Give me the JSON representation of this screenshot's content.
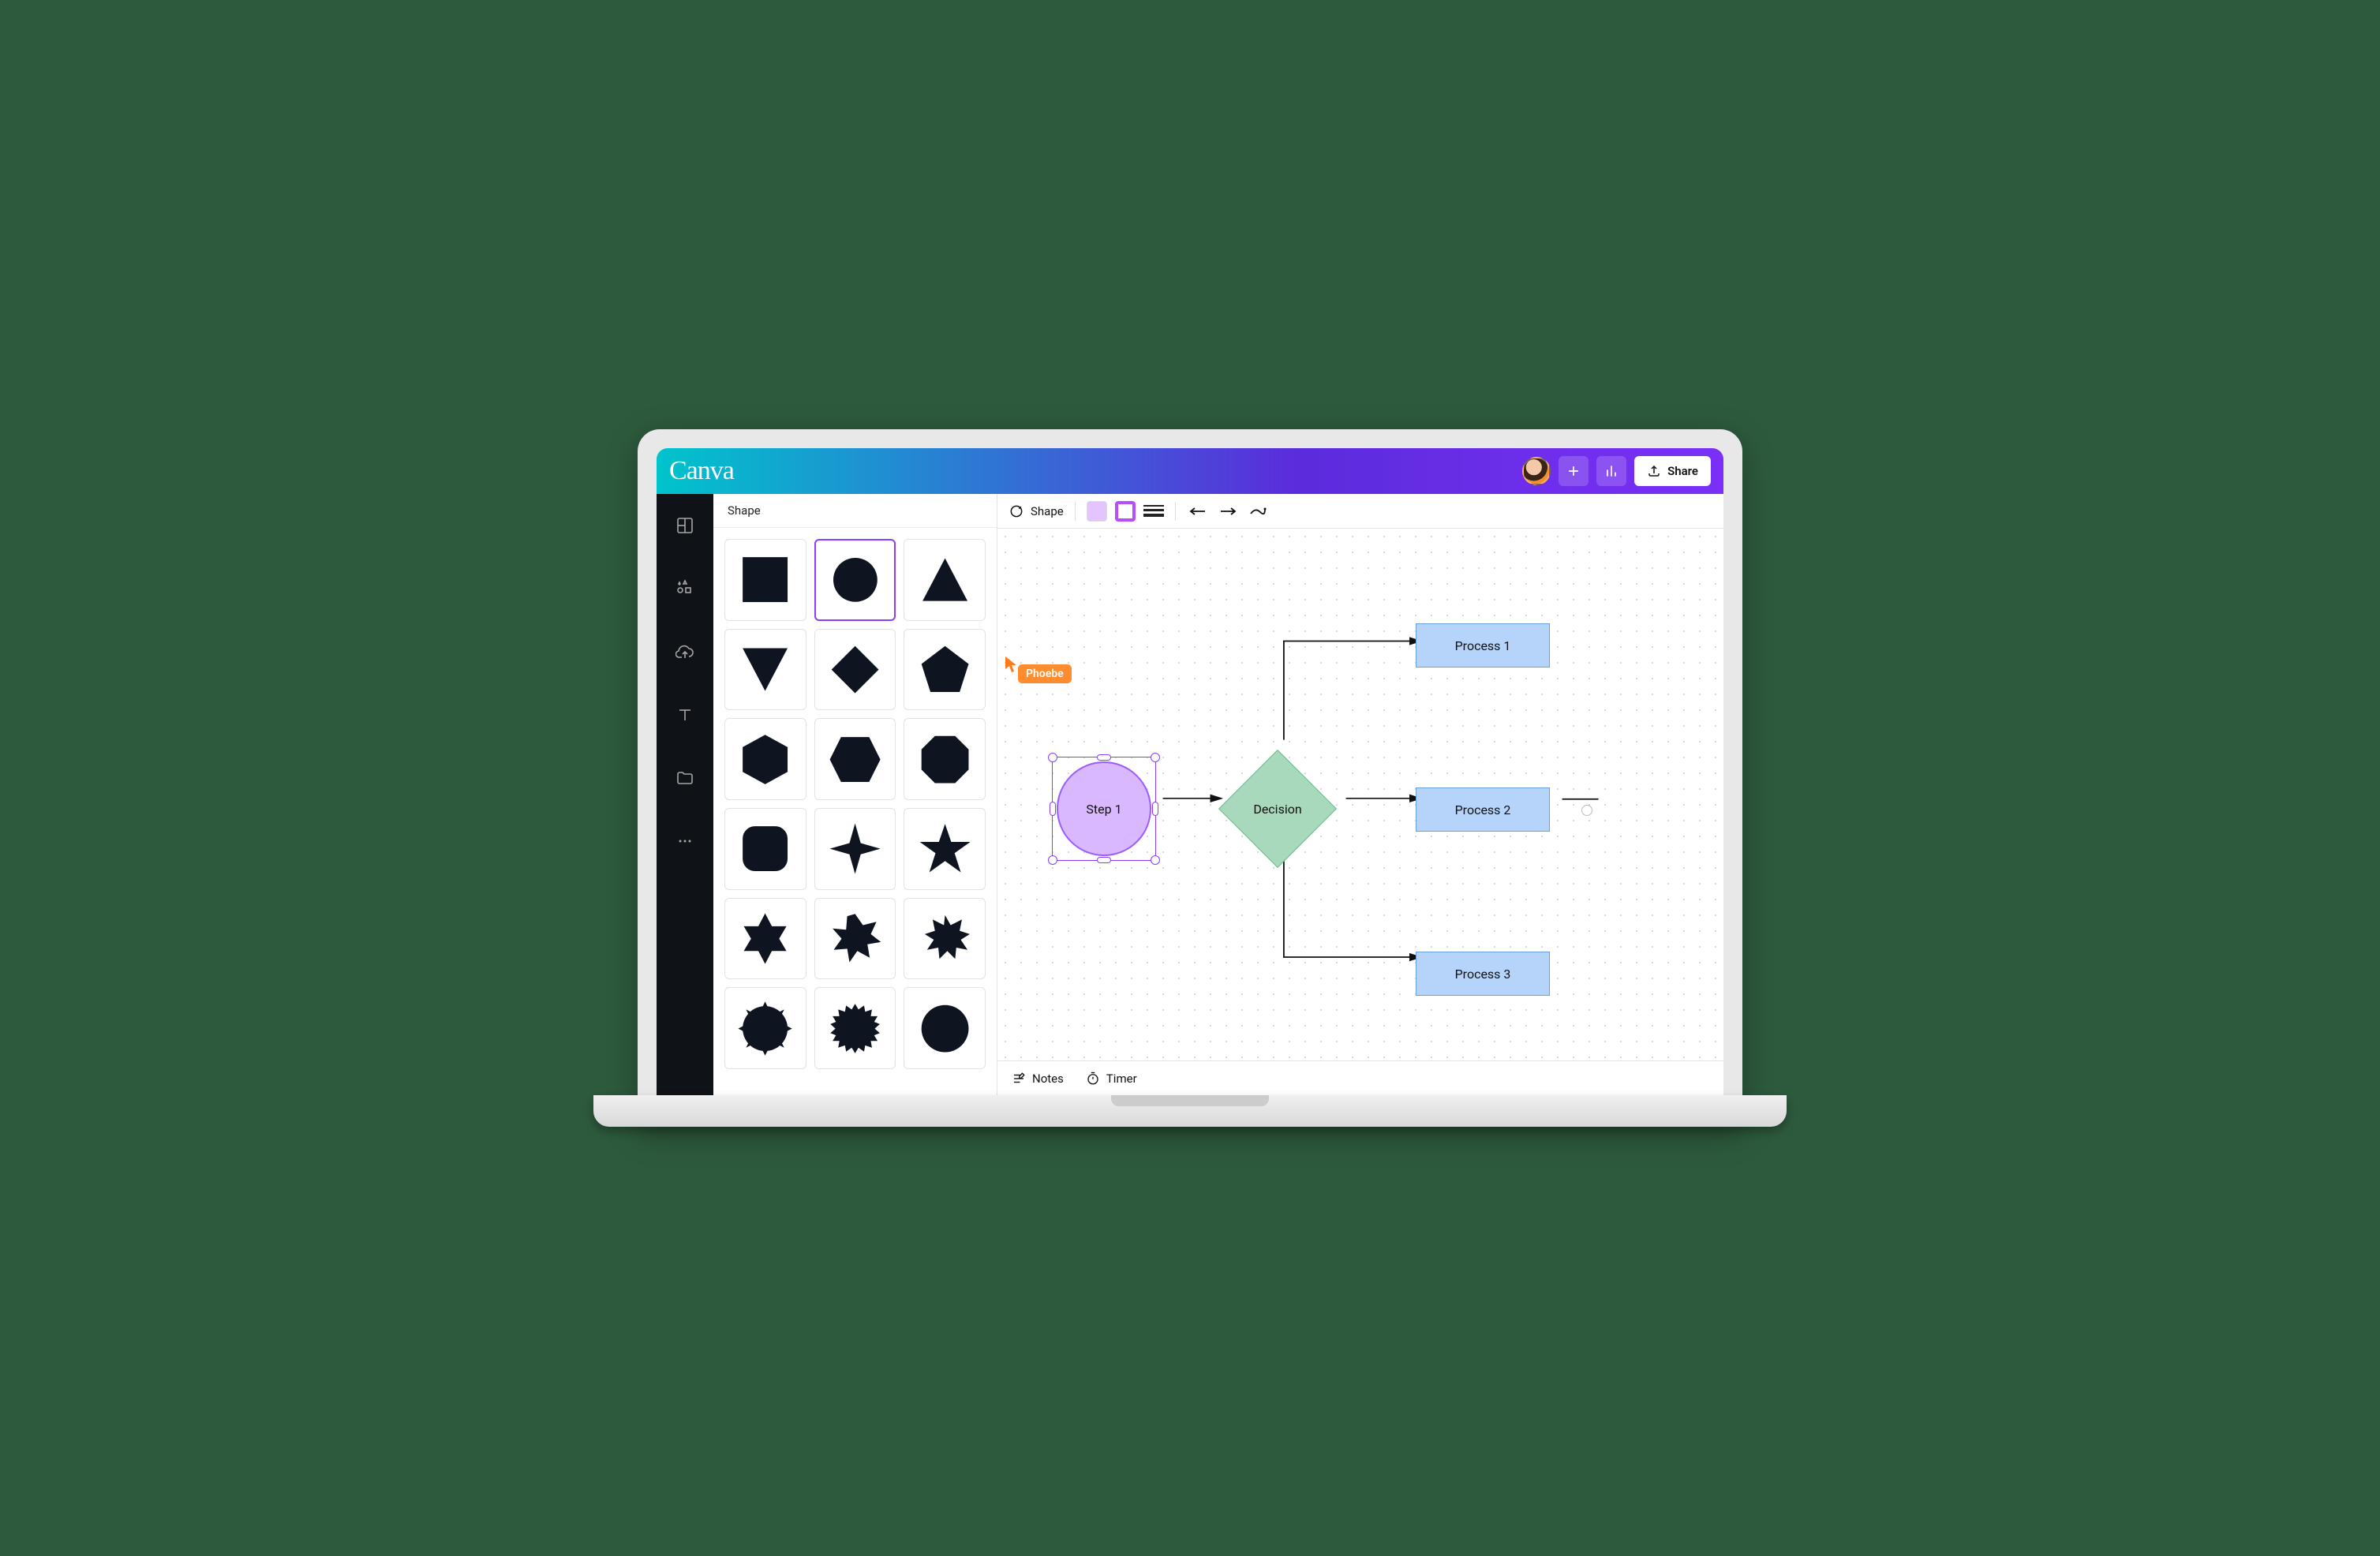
{
  "brand": "Canva",
  "topbar": {
    "share_label": "Share"
  },
  "panel": {
    "title": "Shape",
    "shapes": [
      "square",
      "circle",
      "triangle",
      "triangle-down",
      "diamond",
      "pentagon",
      "hexagon",
      "hexagon-h",
      "octagon",
      "octagon-rounded",
      "star-4",
      "star-5",
      "star-6",
      "burst-8",
      "burst-10",
      "seal-16",
      "seal-20",
      "seal-24"
    ],
    "selected_index": 1
  },
  "context_toolbar": {
    "shape_label": "Shape",
    "fill_color": "#e4c4ff",
    "border_color": "#b84dff"
  },
  "collaborator": {
    "name": "Phoebe",
    "color": "#ff8c2e"
  },
  "canvas": {
    "step": {
      "label": "Step 1"
    },
    "decision": {
      "label": "Decision"
    },
    "processes": [
      {
        "label": "Process 1"
      },
      {
        "label": "Process 2"
      },
      {
        "label": "Process 3"
      }
    ]
  },
  "bottombar": {
    "notes_label": "Notes",
    "timer_label": "Timer"
  }
}
